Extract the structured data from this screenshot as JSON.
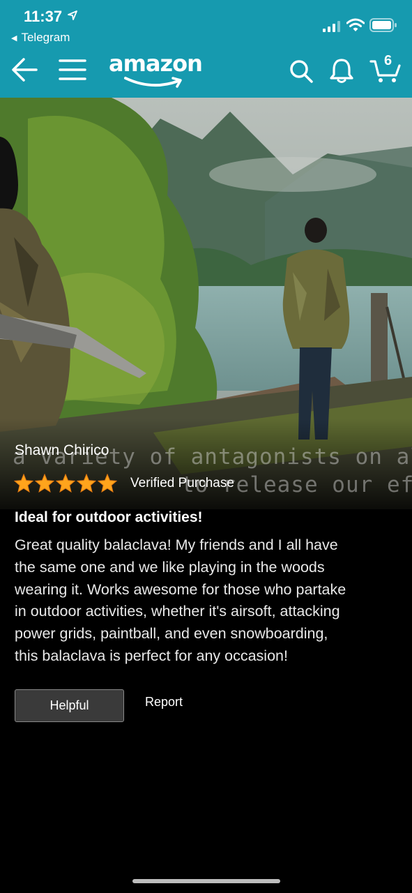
{
  "status_bar": {
    "time": "11:37",
    "back_app": "Telegram"
  },
  "header": {
    "logo_text": "amazon",
    "cart_count": "6",
    "icons": [
      "back-arrow-icon",
      "menu-icon",
      "search-icon",
      "bell-icon",
      "cart-icon"
    ],
    "background_color": "#169aaf"
  },
  "hero": {
    "subtitle_line1": "a variety of antagonists on al",
    "subtitle_line2": "to release our efforts."
  },
  "review": {
    "reviewer_name": "Shawn Chirico",
    "rating": 5,
    "rating_max": 5,
    "star_color": "#ffa41c",
    "verified_label": "Verified Purchase",
    "title": "Ideal for outdoor activities!",
    "body_lines": [
      "Great quality balaclava! My friends and I all have",
      "the same one and we like playing in the woods",
      "wearing it. Works awesome for those who partake",
      "in outdoor activities, whether it's airsoft, attacking",
      "power grids, paintball, and even snowboarding,",
      "this balaclava is perfect for any occasion!"
    ]
  },
  "actions": {
    "helpful_label": "Helpful",
    "report_label": "Report"
  }
}
